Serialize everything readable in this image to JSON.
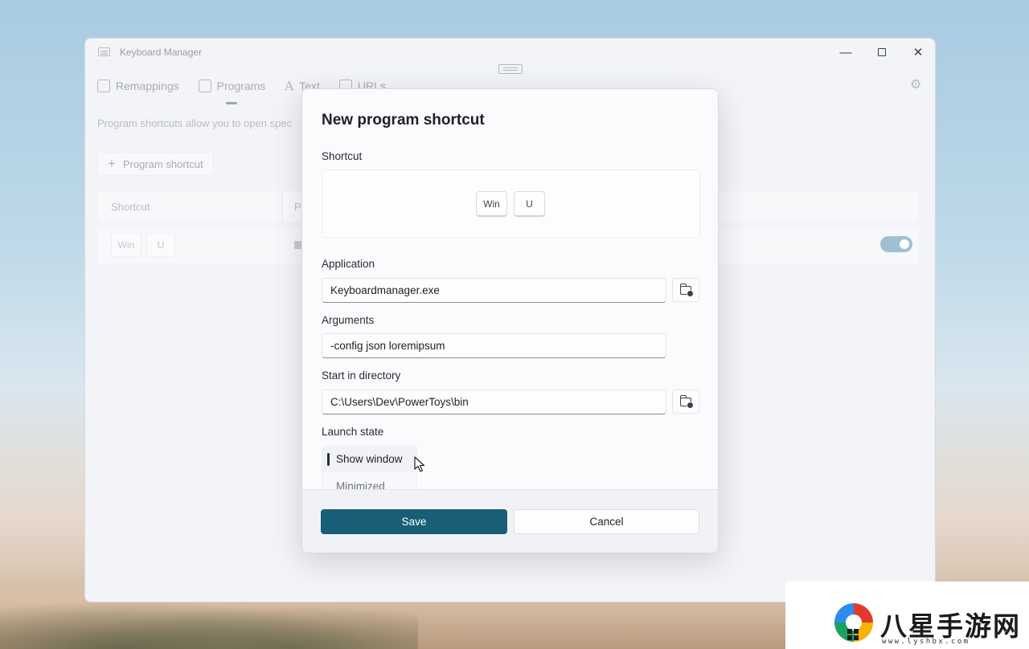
{
  "window": {
    "title": "Keyboard Manager",
    "minimize_glyph": "—",
    "close_glyph": "✕"
  },
  "nav": {
    "tabs": [
      {
        "label": "Remappings",
        "icon": "remap-icon"
      },
      {
        "label": "Programs",
        "icon": "programs-icon",
        "active": true
      },
      {
        "label": "Text",
        "icon": "text-icon"
      },
      {
        "label": "URLs",
        "icon": "link-icon"
      }
    ],
    "text_icon_glyph": "A",
    "settings_glyph": "⚙"
  },
  "main": {
    "description": "Program shortcuts allow you to open spec",
    "add_button_label": "Program shortcut",
    "add_button_glyph": "+",
    "columns": {
      "shortcut": "Shortcut",
      "program": "Pr"
    },
    "row": {
      "keys": [
        "Win",
        "U"
      ],
      "enabled": true
    }
  },
  "dialog": {
    "title": "New program shortcut",
    "shortcut_label": "Shortcut",
    "shortcut_keys": [
      "Win",
      "U"
    ],
    "application_label": "Application",
    "application_value": "Keyboardmanager.exe",
    "arguments_label": "Arguments",
    "arguments_value": "-config json loremipsum",
    "start_dir_label": "Start in directory",
    "start_dir_value": "C:\\Users\\Dev\\PowerToys\\bin",
    "launch_state_label": "Launch state",
    "launch_state_options": [
      "Show window",
      "Minimized"
    ],
    "save_label": "Save",
    "cancel_label": "Cancel"
  },
  "watermark": {
    "text": "八星手游网",
    "url": "www.lyshbx.com"
  },
  "colors": {
    "accent": "#175e76",
    "toggle_on": "#9fc0d0",
    "dialog_bg": "#fbfbfd"
  }
}
